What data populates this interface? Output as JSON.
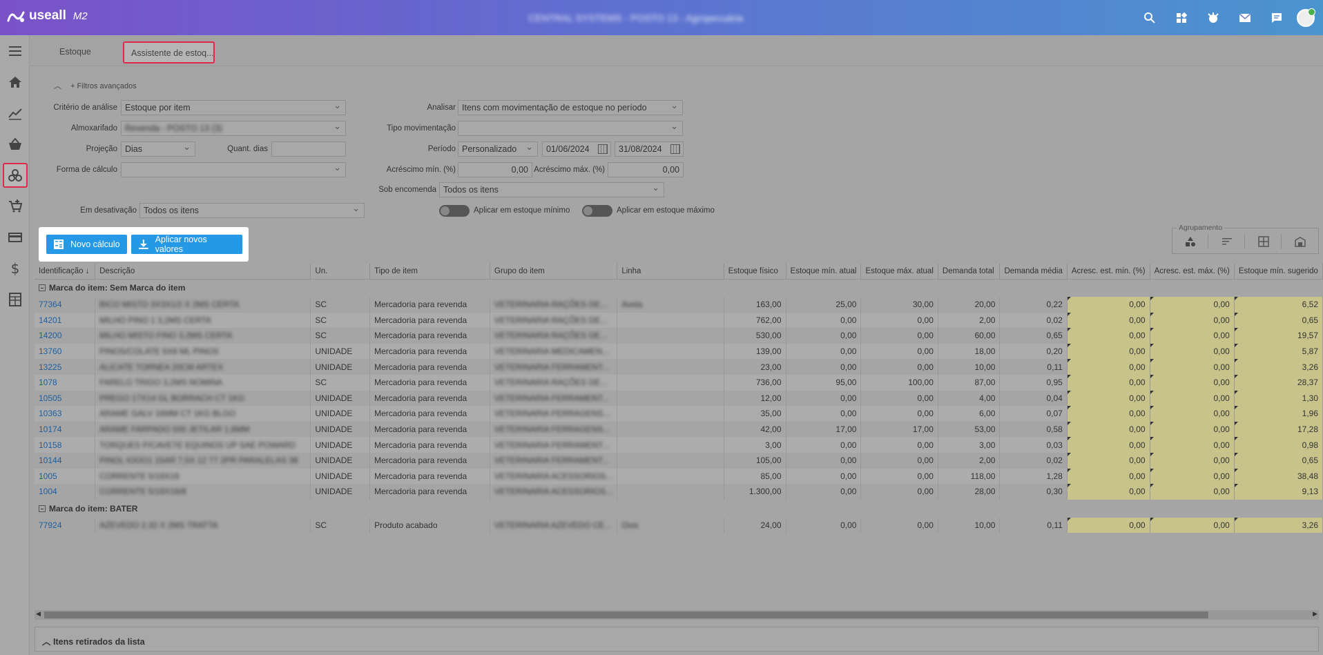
{
  "app": {
    "brand": "useall",
    "version_label": "M2",
    "center_title": "CENTRAL SYSTEMS - POSTO 13 - Agropecuária"
  },
  "tabs": [
    {
      "label": "Estoque"
    },
    {
      "label": "Assistente de estoq..."
    }
  ],
  "filters": {
    "advanced_label": "Filtros avançados",
    "criterio_label": "Critério de análise",
    "criterio_value": "Estoque por item",
    "almox_label": "Almoxarifado",
    "almox_value": "Revenda - POSTO 13 (3)",
    "projecao_label": "Projeção",
    "projecao_value": "Dias",
    "quant_dias_label": "Quant. dias",
    "quant_dias_value": "",
    "forma_label": "Forma de cálculo",
    "forma_value": "",
    "analisar_label": "Analisar",
    "analisar_value": "Itens com movimentação de estoque no período",
    "tipo_mov_label": "Tipo movimentação",
    "tipo_mov_value": "",
    "periodo_label": "Período",
    "periodo_value": "Personalizado",
    "data_ini": "01/06/2024",
    "data_fim": "31/08/2024",
    "acresc_min_label": "Acréscimo mín. (%)",
    "acresc_min_value": "0,00",
    "acresc_max_label": "Acréscimo máx. (%)",
    "acresc_max_value": "0,00",
    "sob_encomenda_label": "Sob encomenda",
    "sob_encomenda_value": "Todos os itens",
    "desativacao_label": "Em desativação",
    "desativacao_value": "Todos os itens",
    "aplicar_min_label": "Aplicar em estoque mínimo",
    "aplicar_max_label": "Aplicar em estoque máximo"
  },
  "buttons": {
    "novo_calculo": "Novo cálculo",
    "aplicar_valores": "Aplicar novos valores"
  },
  "agrupamento_label": "Agrupamento",
  "columns": [
    "Identificação",
    "Descrição",
    "Un.",
    "Tipo de item",
    "Grupo do item",
    "Linha",
    "Estoque físico",
    "Estoque mín. atual",
    "Estoque máx. atual",
    "Demanda total",
    "Demanda média",
    "Acresc. est. mín. (%)",
    "Acresc. est. máx. (%)",
    "Estoque mín. sugerido"
  ],
  "groups": [
    {
      "label": "Marca do item: Sem Marca do item",
      "rows": [
        [
          "77364",
          "BICO MISTO 3X3X1/2 X 2MS CERTA",
          "SC",
          "Mercadoria para revenda",
          "VETERINARIA RAÇÕES DE...",
          "Avela",
          "163,00",
          "25,00",
          "30,00",
          "20,00",
          "0,22",
          "0,00",
          "0,00",
          "6,52"
        ],
        [
          "14201",
          "MILHO PINO 1 3,2MS CERTA",
          "SC",
          "Mercadoria para revenda",
          "VETERINARIA RAÇÕES DE...",
          "",
          "762,00",
          "0,00",
          "0,00",
          "2,00",
          "0,02",
          "0,00",
          "0,00",
          "0,65"
        ],
        [
          "14200",
          "MILHO MISTO FINO 3,2MS CERTA",
          "SC",
          "Mercadoria para revenda",
          "VETERINARIA RAÇÕES DE...",
          "",
          "530,00",
          "0,00",
          "0,00",
          "60,00",
          "0,65",
          "0,00",
          "0,00",
          "19,57"
        ],
        [
          "13760",
          "PINOS/COLATE 5X8 ML PINOS",
          "UNIDADE",
          "Mercadoria para revenda",
          "VETERINARIA MEDICAMEN...",
          "",
          "139,00",
          "0,00",
          "0,00",
          "18,00",
          "0,20",
          "0,00",
          "0,00",
          "5,87"
        ],
        [
          "13225",
          "ALICATE TORNEA 20CM ARTEX",
          "UNIDADE",
          "Mercadoria para revenda",
          "VETERINARIA FERRAMENT...",
          "",
          "23,00",
          "0,00",
          "0,00",
          "10,00",
          "0,11",
          "0,00",
          "0,00",
          "3,26"
        ],
        [
          "1078",
          "FARELO TRIGO 3,2MS NOMINA",
          "SC",
          "Mercadoria para revenda",
          "VETERINARIA RAÇÕES DE...",
          "",
          "736,00",
          "95,00",
          "100,00",
          "87,00",
          "0,95",
          "0,00",
          "0,00",
          "28,37"
        ],
        [
          "10505",
          "PREGO 17X14 GL BORRACH CT 1KG",
          "UNIDADE",
          "Mercadoria para revenda",
          "VETERINARIA FERRAMENT...",
          "",
          "12,00",
          "0,00",
          "0,00",
          "4,00",
          "0,04",
          "0,00",
          "0,00",
          "1,30"
        ],
        [
          "10363",
          "ARAME GALV 16MM CT 1KG BLGO",
          "UNIDADE",
          "Mercadoria para revenda",
          "VETERINARIA FERRAGENS...",
          "",
          "35,00",
          "0,00",
          "0,00",
          "6,00",
          "0,07",
          "0,00",
          "0,00",
          "1,96"
        ],
        [
          "10174",
          "ARAME FARPADO 500 JETILAR 1,6MM",
          "UNIDADE",
          "Mercadoria para revenda",
          "VETERINARIA FERRAGENS...",
          "",
          "42,00",
          "17,00",
          "17,00",
          "53,00",
          "0,58",
          "0,00",
          "0,00",
          "17,28"
        ],
        [
          "10158",
          "TORQUES P/CAVETE EQUINOS UP SAE POWARD",
          "UNIDADE",
          "Mercadoria para revenda",
          "VETERINARIA FERRAMENT...",
          "",
          "3,00",
          "0,00",
          "0,00",
          "3,00",
          "0,03",
          "0,00",
          "0,00",
          "0,98"
        ],
        [
          "10144",
          "PINOL IOOO1 15AR 7,5X 12 77 2PR PARALELAS 38",
          "UNIDADE",
          "Mercadoria para revenda",
          "VETERINARIA FERRAMENT...",
          "",
          "105,00",
          "0,00",
          "0,00",
          "2,00",
          "0,02",
          "0,00",
          "0,00",
          "0,65"
        ],
        [
          "1005",
          "CORRENTE 5/16X16",
          "UNIDADE",
          "Mercadoria para revenda",
          "VETERINARIA ACESSORIOS...",
          "",
          "85,00",
          "0,00",
          "0,00",
          "118,00",
          "1,28",
          "0,00",
          "0,00",
          "38,48"
        ],
        [
          "1004",
          "CORRENTE 5/16X16/8",
          "UNIDADE",
          "Mercadoria para revenda",
          "VETERINARIA ACESSORIOS...",
          "",
          "1.300,00",
          "0,00",
          "0,00",
          "28,00",
          "0,30",
          "0,00",
          "0,00",
          "9,13"
        ]
      ]
    },
    {
      "label": "Marca do item: BATER",
      "rows": [
        [
          "77924",
          "AZEVEDO 2,32 X 2MS TRATTA",
          "SC",
          "Produto acabado",
          "VETERINARIA AZEVEDO CE...",
          "Ovis",
          "24,00",
          "0,00",
          "0,00",
          "10,00",
          "0,11",
          "0,00",
          "0,00",
          "3,26"
        ]
      ]
    }
  ],
  "bottom": {
    "label": "Itens retirados da lista"
  }
}
